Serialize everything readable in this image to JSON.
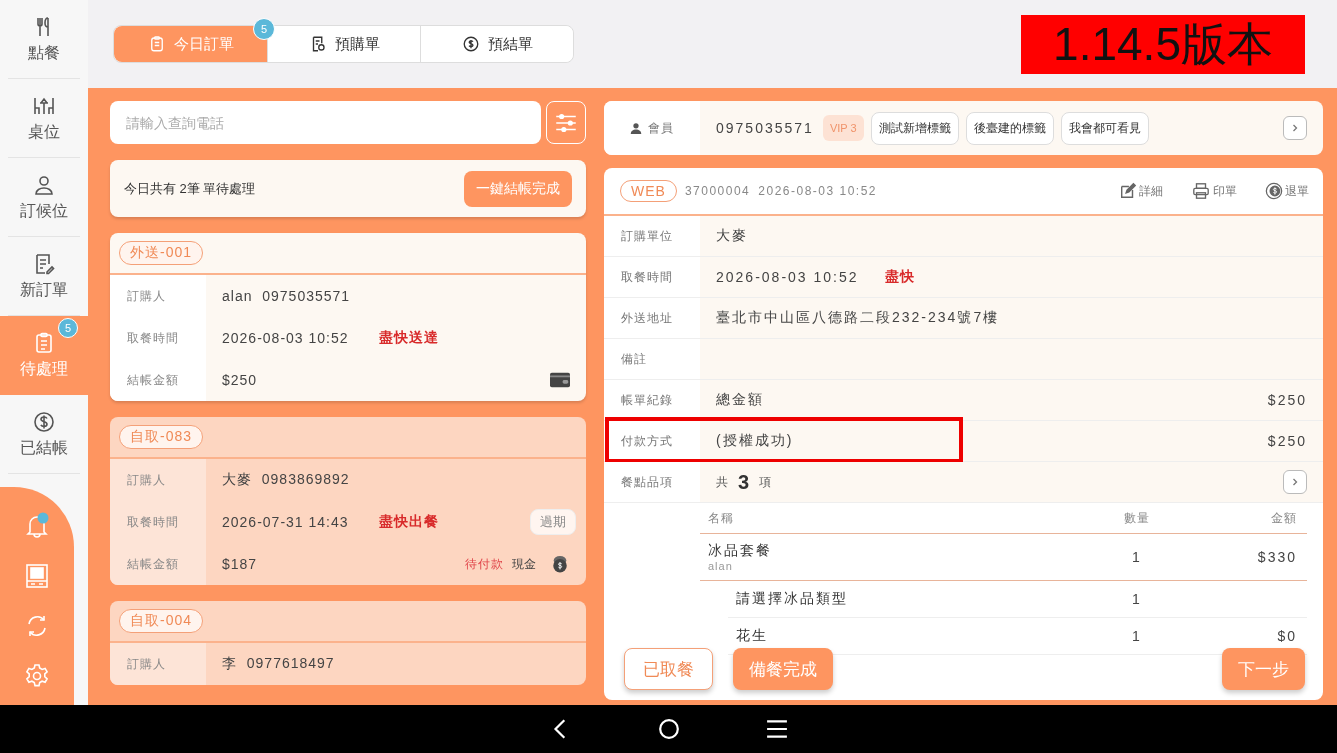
{
  "sidebar": {
    "items": [
      {
        "kind": "utensils",
        "label": "點餐",
        "selected": false
      },
      {
        "kind": "table",
        "label": "桌位",
        "selected": false
      },
      {
        "kind": "person",
        "label": "訂候位",
        "selected": false
      },
      {
        "kind": "form",
        "label": "新訂單",
        "selected": false
      },
      {
        "kind": "clipboard",
        "label": "待處理",
        "selected": true,
        "badge": "5"
      },
      {
        "kind": "dollar",
        "label": "已結帳",
        "selected": false
      }
    ],
    "tools": [
      {
        "kind": "bell",
        "alert": true
      },
      {
        "kind": "register",
        "alert": false
      },
      {
        "kind": "sync",
        "alert": false
      },
      {
        "kind": "settings",
        "alert": false
      }
    ]
  },
  "tabs": [
    {
      "kind": "clipboard",
      "label": "今日訂單",
      "selected": true,
      "badge": "5"
    },
    {
      "kind": "receipt",
      "label": "預購單",
      "selected": false
    },
    {
      "kind": "dollar",
      "label": "預結單",
      "selected": false
    }
  ],
  "version_badge": "1.14.5版本",
  "search": {
    "placeholder": "請輸入查詢電話"
  },
  "summary": {
    "text": "今日共有 2筆 單待處理",
    "button": "一鍵結帳完成"
  },
  "orders": [
    {
      "tag": "外送-001",
      "selected": true,
      "fields": [
        {
          "label": "訂購人",
          "value": "alan  0975035571"
        },
        {
          "label": "取餐時間",
          "value": "2026-08-03 10:52",
          "note": "盡快送達"
        },
        {
          "label": "結帳金額",
          "value": "$250"
        }
      ]
    },
    {
      "tag": "自取-083",
      "selected": false,
      "fields": [
        {
          "label": "訂購人",
          "value": "大麥  0983869892"
        },
        {
          "label": "取餐時間",
          "value": "2026-07-31 14:43",
          "note": "盡快出餐",
          "badge": "過期"
        },
        {
          "label": "結帳金額",
          "value": "$187",
          "status": "待付款",
          "method": "現金"
        }
      ]
    },
    {
      "tag": "自取-004",
      "selected": false,
      "fields": [
        {
          "label": "訂購人",
          "value": "李  0977618497"
        }
      ]
    }
  ],
  "member": {
    "label": "會員",
    "phone": "0975035571",
    "level": "VIP 3",
    "tags": [
      "測試新增標籤",
      "後臺建的標籤",
      "我會都可看見"
    ]
  },
  "order_detail": {
    "source": "WEB",
    "number": "37000004",
    "created": "2026-08-03 10:52",
    "actions": [
      {
        "kind": "edit",
        "label": "詳細"
      },
      {
        "kind": "print",
        "label": "印單"
      },
      {
        "kind": "refund",
        "label": "退單"
      }
    ],
    "rows": [
      {
        "kind": "text",
        "label": "訂購單位",
        "value": "大麥",
        "highlighted": false
      },
      {
        "kind": "text",
        "label": "取餐時間",
        "value": "2026-08-03 10:52",
        "note": "盡快",
        "highlighted": false
      },
      {
        "kind": "text",
        "label": "外送地址",
        "value": "臺北市中山區八德路二段232-234號7樓",
        "highlighted": false
      },
      {
        "kind": "text",
        "label": "備註",
        "highlighted": false
      },
      {
        "kind": "text",
        "label": "帳單紀錄",
        "value": "總金額",
        "amount": "$250",
        "highlighted": false
      },
      {
        "kind": "text",
        "label": "付款方式",
        "value": "(授權成功)",
        "amount": "$250",
        "highlighted": true
      },
      {
        "kind": "count",
        "label": "餐點品項",
        "prefix": "共",
        "count": "3",
        "suffix": "項",
        "highlighted": false
      }
    ],
    "items": {
      "columns": [
        "名稱",
        "數量",
        "金額"
      ],
      "rows": [
        {
          "name": "冰品套餐",
          "sub": "alan",
          "qty": "1",
          "amount": "$330",
          "children": [
            {
              "name": "請選擇冰品類型",
              "qty": "1"
            },
            {
              "name": "花生",
              "qty": "1",
              "amount": "$0"
            }
          ]
        }
      ]
    }
  },
  "buttons": [
    {
      "kind": "outline",
      "label": "已取餐"
    },
    {
      "kind": "filled",
      "label": "備餐完成"
    },
    {
      "kind": "filled",
      "label": "下一步"
    }
  ]
}
